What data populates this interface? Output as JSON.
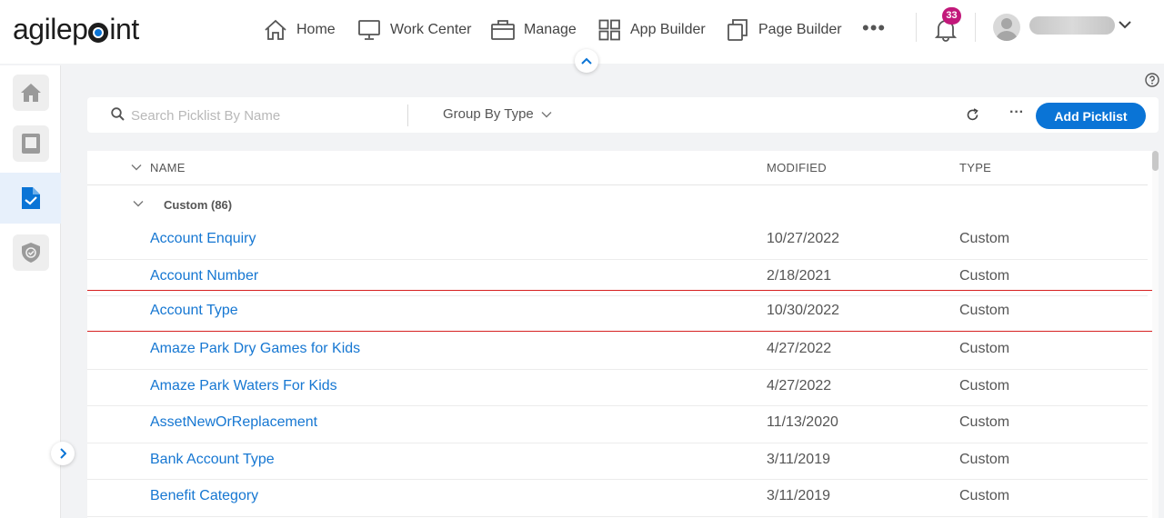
{
  "app": {
    "logo_text_1": "agilep",
    "logo_text_2": "int"
  },
  "nav": [
    {
      "label": "Home",
      "icon": "home-icon"
    },
    {
      "label": "Work Center",
      "icon": "monitor-icon"
    },
    {
      "label": "Manage",
      "icon": "briefcase-icon"
    },
    {
      "label": "App Builder",
      "icon": "grid-icon"
    },
    {
      "label": "Page Builder",
      "icon": "pages-icon"
    }
  ],
  "notifications": {
    "count": "33"
  },
  "rail": [
    {
      "icon": "home-icon",
      "active": false
    },
    {
      "icon": "tablet-icon",
      "active": false
    },
    {
      "icon": "picklist-icon",
      "active": true
    },
    {
      "icon": "shield-icon",
      "active": false
    }
  ],
  "toolbar": {
    "search_placeholder": "Search Picklist By Name",
    "group_by_label": "Group By Type",
    "add_button_label": "Add Picklist"
  },
  "table": {
    "headers": {
      "name": "NAME",
      "modified": "MODIFIED",
      "type": "TYPE"
    },
    "group_label": "Custom (86)",
    "rows": [
      {
        "name": "Account Enquiry",
        "modified": "10/27/2022",
        "type": "Custom"
      },
      {
        "name": "Account Number",
        "modified": "2/18/2021",
        "type": "Custom"
      },
      {
        "name": "Account Type",
        "modified": "10/30/2022",
        "type": "Custom",
        "highlighted": true
      },
      {
        "name": "Amaze Park Dry Games for Kids",
        "modified": "4/27/2022",
        "type": "Custom"
      },
      {
        "name": "Amaze Park Waters For Kids",
        "modified": "4/27/2022",
        "type": "Custom"
      },
      {
        "name": "AssetNewOrReplacement",
        "modified": "11/13/2020",
        "type": "Custom"
      },
      {
        "name": "Bank Account Type",
        "modified": "3/11/2019",
        "type": "Custom"
      },
      {
        "name": "Benefit Category",
        "modified": "3/11/2019",
        "type": "Custom"
      }
    ]
  },
  "colors": {
    "accent": "#0a74d6",
    "link": "#1677d2",
    "badge": "#c2187a",
    "highlight_border": "#d62121"
  }
}
